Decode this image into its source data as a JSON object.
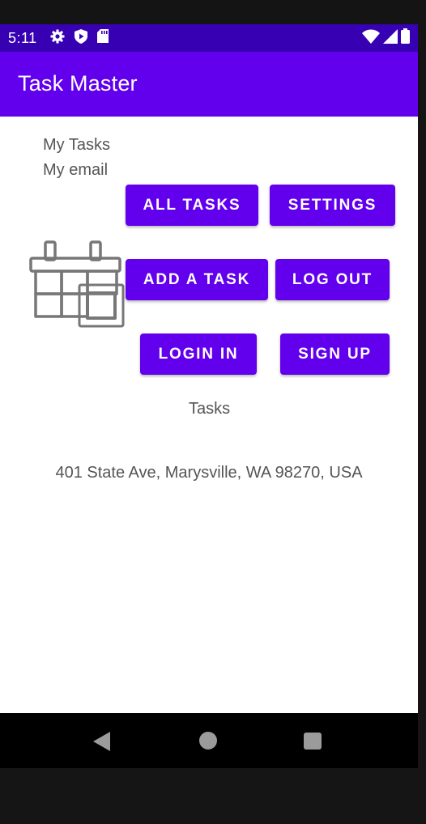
{
  "status_bar": {
    "time": "5:11",
    "left_icons": [
      "gear-icon",
      "shield-icon",
      "sd-card-icon"
    ],
    "right_icons": [
      "wifi-icon",
      "signal-icon",
      "battery-icon"
    ],
    "background": "#3700B3"
  },
  "app_bar": {
    "title": "Task Master",
    "background": "#6200EE"
  },
  "main": {
    "my_tasks_label": "My Tasks",
    "my_email_label": "My email",
    "buttons": {
      "all_tasks": "ALL TASKS",
      "settings": "SETTINGS",
      "add_a_task": "ADD A TASK",
      "log_out": "LOG OUT",
      "login_in": "LOGIN IN",
      "sign_up": "SIGN UP"
    },
    "tasks_label": "Tasks",
    "address": "401 State Ave, Marysville, WA 98270, USA",
    "image_icon": "calendar-icon"
  },
  "nav_bar": {
    "icons": [
      "back-icon",
      "home-icon",
      "recent-apps-icon"
    ]
  },
  "colors": {
    "primary": "#6200EE",
    "primary_dark": "#3700B3",
    "text": "#555555"
  }
}
